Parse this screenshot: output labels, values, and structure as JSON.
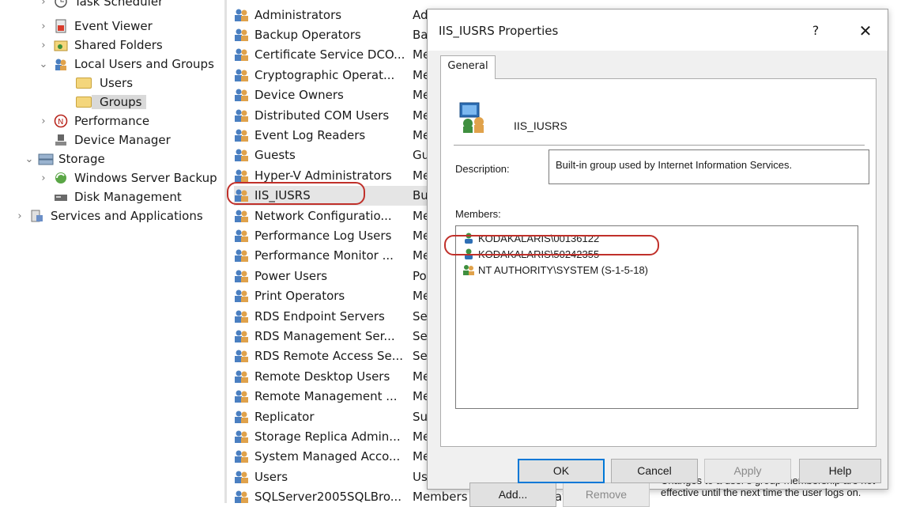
{
  "tree": {
    "items": [
      {
        "label": "Task Scheduler",
        "chevron": "›",
        "icon": "clock-icon"
      },
      {
        "label": "Event Viewer",
        "chevron": "›",
        "icon": "event-viewer-icon"
      },
      {
        "label": "Shared Folders",
        "chevron": "›",
        "icon": "shared-folder-icon"
      },
      {
        "label": "Local Users and Groups",
        "chevron": "⌄",
        "icon": "users-group-icon"
      },
      {
        "label": "Users",
        "chevron": "",
        "icon": "folder-icon"
      },
      {
        "label": "Groups",
        "chevron": "",
        "icon": "folder-icon"
      },
      {
        "label": "Performance",
        "chevron": "›",
        "icon": "performance-icon"
      },
      {
        "label": "Device Manager",
        "chevron": "",
        "icon": "device-manager-icon"
      },
      {
        "label": "Storage",
        "chevron": "⌄",
        "icon": "storage-icon"
      },
      {
        "label": "Windows Server Backup",
        "chevron": "›",
        "icon": "backup-icon"
      },
      {
        "label": "Disk Management",
        "chevron": "",
        "icon": "disk-icon"
      },
      {
        "label": "Services and Applications",
        "chevron": "›",
        "icon": "services-icon"
      }
    ]
  },
  "groups_list": {
    "rows": [
      {
        "name": "Administrators",
        "desc": "Administrators have complete and"
      },
      {
        "name": "Backup Operators",
        "desc": "Bac"
      },
      {
        "name": "Certificate Service DCO...",
        "desc": "Me"
      },
      {
        "name": "Cryptographic Operat...",
        "desc": "Me"
      },
      {
        "name": "Device Owners",
        "desc": "Me"
      },
      {
        "name": "Distributed COM Users",
        "desc": "Me"
      },
      {
        "name": "Event Log Readers",
        "desc": "Me"
      },
      {
        "name": "Guests",
        "desc": "Gu"
      },
      {
        "name": "Hyper-V Administrators",
        "desc": "Me"
      },
      {
        "name": "IIS_IUSRS",
        "desc": "Bu"
      },
      {
        "name": "Network Configuratio...",
        "desc": "Me"
      },
      {
        "name": "Performance Log Users",
        "desc": "Me"
      },
      {
        "name": "Performance Monitor ...",
        "desc": "Me"
      },
      {
        "name": "Power Users",
        "desc": "Po"
      },
      {
        "name": "Print Operators",
        "desc": "Me"
      },
      {
        "name": "RDS Endpoint Servers",
        "desc": "Ser"
      },
      {
        "name": "RDS Management Ser...",
        "desc": "Ser"
      },
      {
        "name": "RDS Remote Access Se...",
        "desc": "Ser"
      },
      {
        "name": "Remote Desktop Users",
        "desc": "Me"
      },
      {
        "name": "Remote Management ...",
        "desc": "Me"
      },
      {
        "name": "Replicator",
        "desc": "Su"
      },
      {
        "name": "Storage Replica Admin...",
        "desc": "Me"
      },
      {
        "name": "System Managed Acco...",
        "desc": "Me"
      },
      {
        "name": "Users",
        "desc": "Us"
      },
      {
        "name": "SQLServer2005SQLBro...",
        "desc": "Members in the group have the re..."
      }
    ],
    "selected_index": 9
  },
  "dialog": {
    "title": "IIS_IUSRS Properties",
    "help_glyph": "?",
    "close_glyph": "✕",
    "tab_general": "General",
    "group_name": "IIS_IUSRS",
    "description_label": "Description:",
    "description_value": "Built-in group used by Internet Information Services.",
    "members_label": "Members:",
    "members": [
      {
        "name": "KODAKALARIS\\00136122",
        "icon": "user-icon"
      },
      {
        "name": "KODAKALARIS\\50242355",
        "icon": "user-icon"
      },
      {
        "name": "NT AUTHORITY\\SYSTEM (S-1-5-18)",
        "icon": "group-icon"
      }
    ],
    "add_label": "Add...",
    "remove_label": "Remove",
    "note": "Changes to a user's group membership are not effective until the next time the user logs on.",
    "ok_label": "OK",
    "cancel_label": "Cancel",
    "apply_label": "Apply",
    "help_label": "Help"
  },
  "colors": {
    "annotation_red": "#c0302a",
    "ok_focus_blue": "#0078d7"
  }
}
